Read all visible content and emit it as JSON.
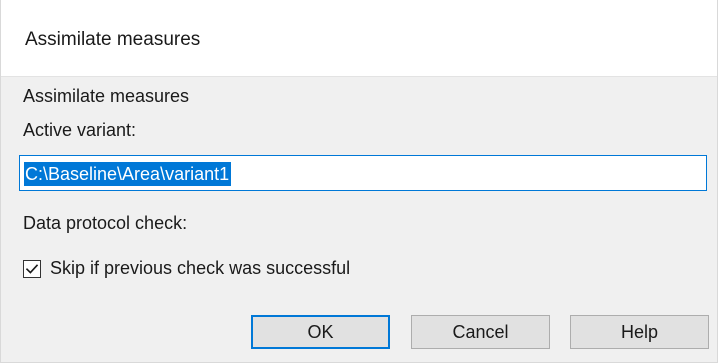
{
  "window": {
    "title": "Assimilate measures"
  },
  "form": {
    "group_label": "Assimilate measures",
    "variant_label": "Active variant:",
    "variant_value": "C:\\Baseline\\Area\\variant1",
    "protocol_label": "Data protocol check:",
    "skip_checkbox": {
      "label": "Skip if previous check was successful",
      "checked": true
    }
  },
  "buttons": {
    "ok_label": "OK",
    "cancel_label": "Cancel",
    "help_label": "Help"
  },
  "colors": {
    "accent": "#0078d7",
    "dialog_background": "#f0f0f0",
    "titlebar_background": "#ffffff",
    "button_background": "#e1e1e1"
  }
}
